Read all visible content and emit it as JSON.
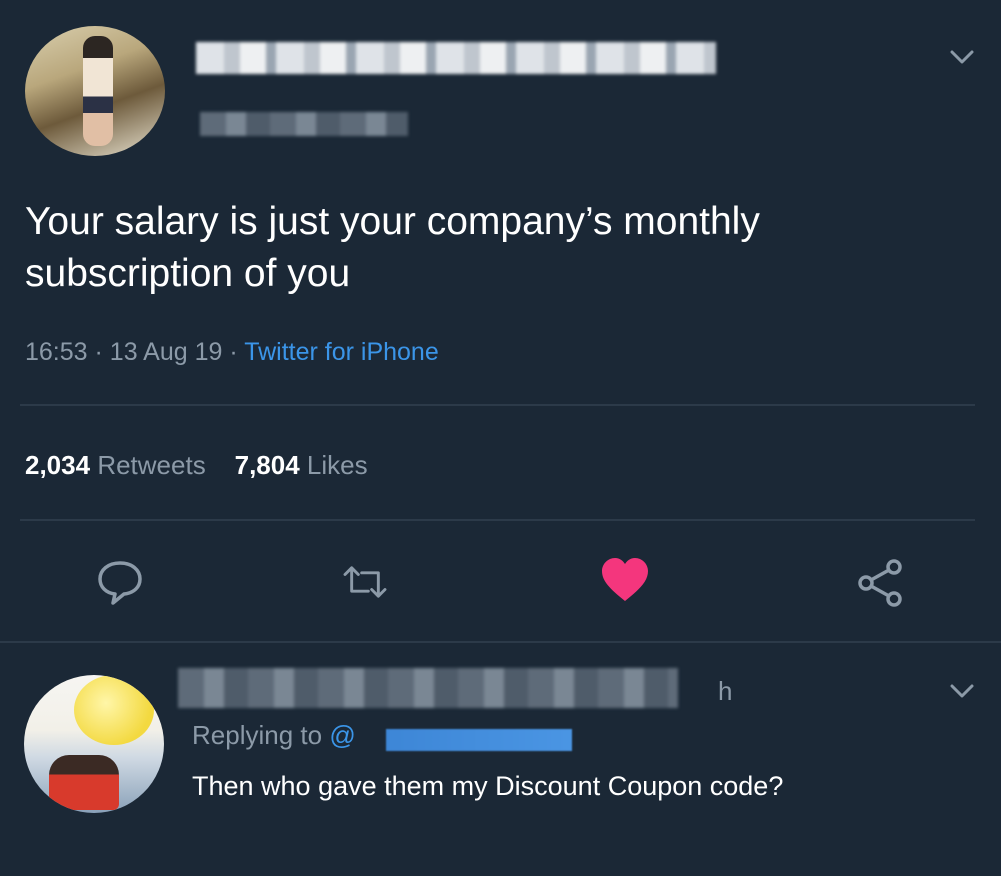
{
  "tweet": {
    "text": "Your salary is just your company’s monthly subscription of you",
    "time": "16:53",
    "date": "13 Aug 19",
    "source": "Twitter for iPhone",
    "separator": "·"
  },
  "stats": {
    "retweets_count": "2,034",
    "retweets_label": "Retweets",
    "likes_count": "7,804",
    "likes_label": "Likes"
  },
  "actions": {
    "icons": [
      "reply-icon",
      "retweet-icon",
      "like-heart-icon",
      "share-icon"
    ],
    "liked": true
  },
  "reply": {
    "time": "h",
    "replying_to_label": "Replying to",
    "mention": "@",
    "text": "Then who gave them my Discount Coupon code?"
  },
  "colors": {
    "background": "#1b2836",
    "secondary_text": "#8c9aa8",
    "link": "#3b95e8",
    "like": "#f4367d"
  }
}
